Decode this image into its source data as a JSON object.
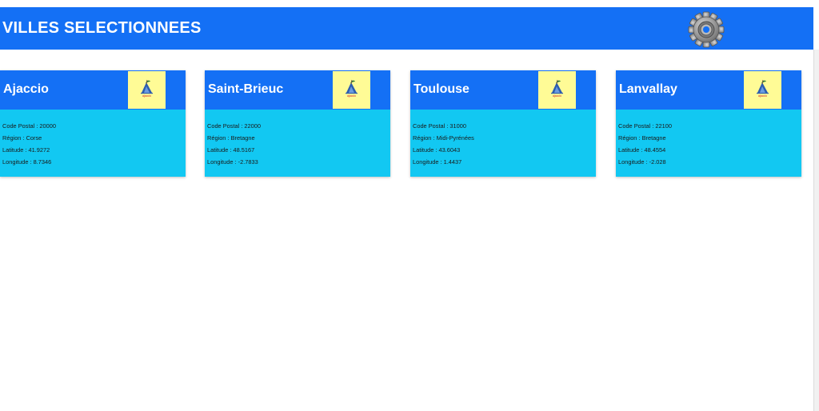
{
  "header": {
    "title": "VILLES SELECTIONNEES",
    "settings_icon": "gear-icon"
  },
  "colors": {
    "header_blue": "#1470f5",
    "card_body": "#12c8f2",
    "logo_bg": "#fffb96"
  },
  "cities": [
    {
      "name": "Ajaccio",
      "logo_text": "ajaccio",
      "code_postal": "Code Postal : 20000",
      "region": "Région : Corse",
      "latitude": "Latitude : 41.9272",
      "longitude": "Longitude : 8.7346"
    },
    {
      "name": "Saint-Brieuc",
      "logo_text": "ajaccio",
      "code_postal": "Code Postal : 22000",
      "region": "Région : Bretagne",
      "latitude": "Latitude : 48.5167",
      "longitude": "Longitude : -2.7833"
    },
    {
      "name": "Toulouse",
      "logo_text": "ajaccio",
      "code_postal": "Code Postal : 31000",
      "region": "Région : Midi-Pyrénées",
      "latitude": "Latitude : 43.6043",
      "longitude": "Longitude : 1.4437"
    },
    {
      "name": "Lanvallay",
      "logo_text": "ajaccio",
      "code_postal": "Code Postal : 22100",
      "region": "Région : Bretagne",
      "latitude": "Latitude : 48.4554",
      "longitude": "Longitude : -2.028"
    }
  ]
}
